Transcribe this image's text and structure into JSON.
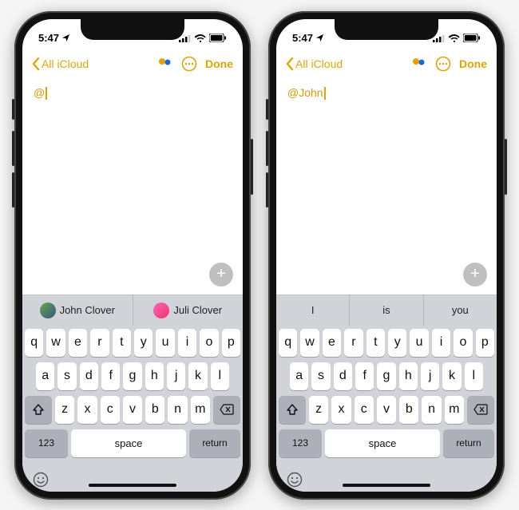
{
  "status": {
    "time": "5:47",
    "locationIcon": "location-arrow",
    "signalIcon": "cell-signal",
    "wifiIcon": "wifi",
    "batteryIcon": "battery-full"
  },
  "nav": {
    "backLabel": "All iCloud",
    "collabIcon": "collaborate",
    "moreIcon": "ellipsis-circle",
    "doneLabel": "Done"
  },
  "noteLeft": {
    "text": "@"
  },
  "noteRight": {
    "text": "@John"
  },
  "plusLabel": "+",
  "suggestLeft": {
    "items": [
      "John Clover",
      "Juli Clover"
    ]
  },
  "suggestRight": {
    "items": [
      "I",
      "is",
      "you"
    ]
  },
  "keyboard": {
    "row1": [
      "q",
      "w",
      "e",
      "r",
      "t",
      "y",
      "u",
      "i",
      "o",
      "p"
    ],
    "row2": [
      "a",
      "s",
      "d",
      "f",
      "g",
      "h",
      "j",
      "k",
      "l"
    ],
    "row3": [
      "z",
      "x",
      "c",
      "v",
      "b",
      "n",
      "m"
    ],
    "shiftIcon": "shift",
    "deleteIcon": "delete",
    "numLabel": "123",
    "spaceLabel": "space",
    "returnLabel": "return",
    "emojiIcon": "emoji"
  }
}
